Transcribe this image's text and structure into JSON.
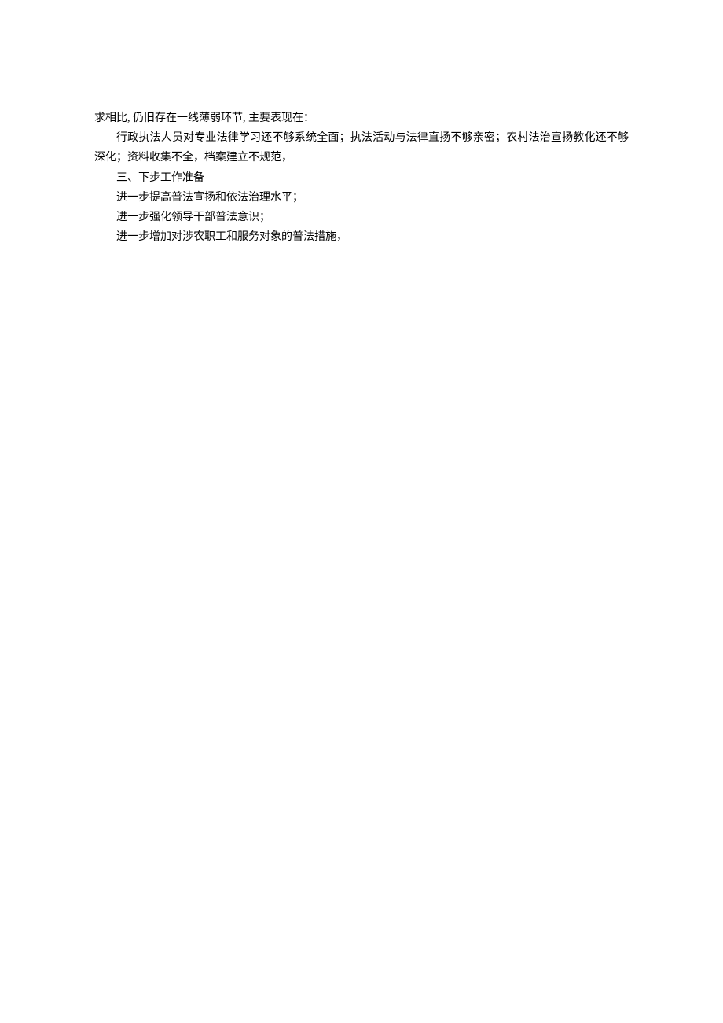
{
  "paragraphs": {
    "p1": "求相比, 仍旧存在一线薄弱环节, 主要表现在：",
    "p2": "行政执法人员对专业法律学习还不够系统全面；执法活动与法律直扬不够亲密；农村法治宣扬教化还不够深化；资料收集不全，档案建立不规范，",
    "p3": "三、下步工作准备",
    "p4": "进一步提高普法宣扬和依法治理水平；",
    "p5": "进一步强化领导干部普法意识；",
    "p6": "进一步增加对涉农职工和服务对象的普法措施，"
  }
}
